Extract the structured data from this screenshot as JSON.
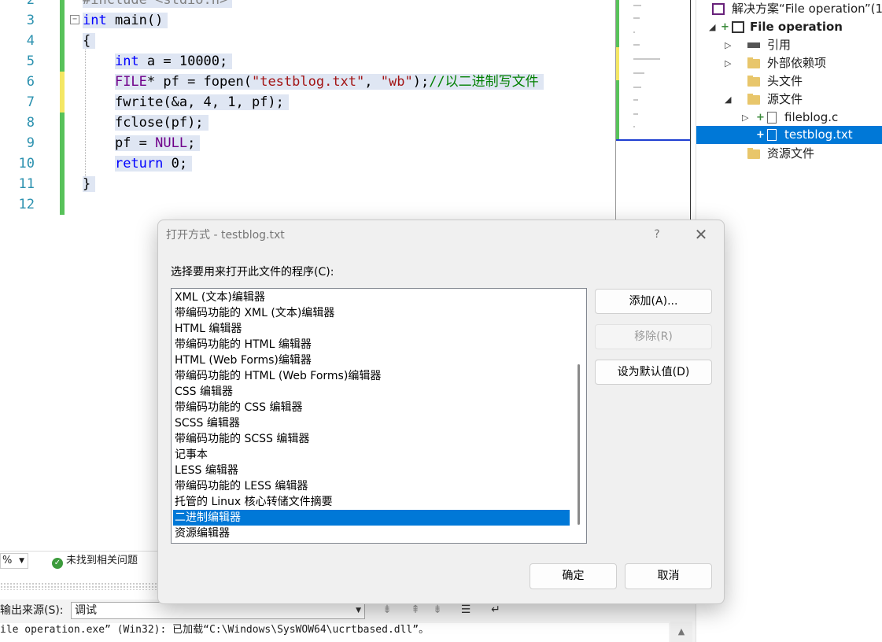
{
  "editor": {
    "line_numbers": [
      "2",
      "3",
      "4",
      "5",
      "6",
      "7",
      "8",
      "9",
      "10",
      "11",
      "12"
    ],
    "lines": {
      "l2": "#include <stdio.h>",
      "l3_type": "int",
      "l3_rest": " main()",
      "l4": "{",
      "l5_type": "int",
      "l5_rest": " a = 10000;",
      "l6_type": "FILE",
      "l6_a": "* pf = fopen(",
      "l6_s1": "\"testblog.txt\"",
      "l6_b": ", ",
      "l6_s2": "\"wb\"",
      "l6_c": ");",
      "l6_comment": "//以二进制写文件",
      "l7": "fwrite(&a, 4, 1, pf);",
      "l8": "fclose(pf);",
      "l9_a": "pf = ",
      "l9_null": "NULL",
      "l9_b": ";",
      "l10_kw": "return",
      "l10_rest": " 0;",
      "l11": "}"
    },
    "fold_glyph": "−"
  },
  "solution_explorer": {
    "solution_label": "解决方案“File operation”(1",
    "project_label": "File operation",
    "items": [
      {
        "label": "引用"
      },
      {
        "label": "外部依赖项"
      },
      {
        "label": "头文件"
      },
      {
        "label": "源文件"
      },
      {
        "label": "fileblog.c"
      },
      {
        "label": "testblog.txt"
      },
      {
        "label": "资源文件"
      }
    ]
  },
  "status": {
    "zoom": "%",
    "issues": "未找到相关问题"
  },
  "output": {
    "source_label": "输出来源(S):",
    "source_value": "调试",
    "text": "ile operation.exe” (Win32): 已加载“C:\\Windows\\SysWOW64\\ucrtbased.dll”。"
  },
  "dialog": {
    "title": "打开方式 - testblog.txt",
    "help": "?",
    "close": "✕",
    "prompt": "选择要用来打开此文件的程序(C):",
    "programs": [
      "XML (文本)编辑器",
      "带编码功能的 XML (文本)编辑器",
      "HTML 编辑器",
      "带编码功能的 HTML 编辑器",
      "HTML (Web Forms)编辑器",
      "带编码功能的 HTML (Web Forms)编辑器",
      "CSS 编辑器",
      "带编码功能的 CSS 编辑器",
      "SCSS 编辑器",
      "带编码功能的 SCSS 编辑器",
      "记事本",
      "LESS 编辑器",
      "带编码功能的 LESS 编辑器",
      "托管的 Linux 核心转储文件摘要",
      "二进制编辑器",
      "资源编辑器"
    ],
    "selected_program": "二进制编辑器",
    "add_button": "添加(A)...",
    "remove_button": "移除(R)",
    "set_default_button": "设为默认值(D)",
    "ok_button": "确定",
    "cancel_button": "取消"
  },
  "colors": {
    "selection": "#0078d7",
    "keyword": "#0000ff",
    "string": "#a31515",
    "comment": "#008000",
    "macro": "#6f008a",
    "line_number": "#2b91af"
  }
}
